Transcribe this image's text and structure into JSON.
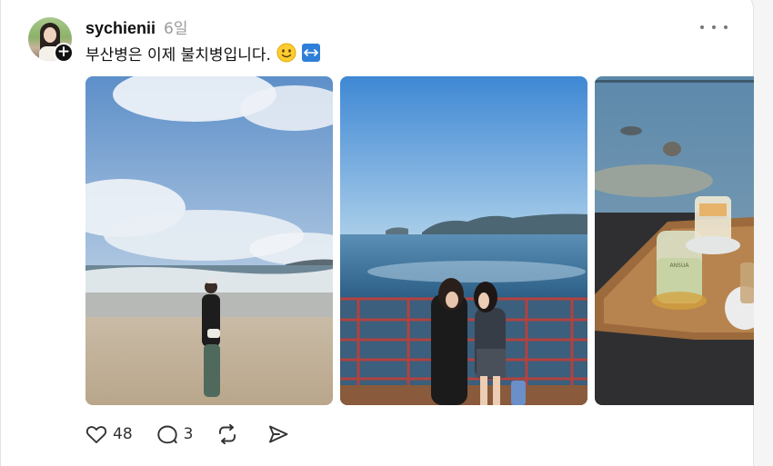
{
  "post": {
    "username": "sychienii",
    "time": "6일",
    "caption": "부산병은 이제 불치병입니다.",
    "caption_emojis": [
      "slightly-smiling-face",
      "left-right-arrow"
    ],
    "follow_symbol": "+",
    "more_label": "more-options"
  },
  "photos": [
    {
      "name": "beach-photo"
    },
    {
      "name": "ocean-terrace-photo"
    },
    {
      "name": "cafe-drinks-photo",
      "cup_text": "ANSUA"
    }
  ],
  "actions": {
    "likes": "48",
    "comments": "3",
    "repost_label": "",
    "share_label": ""
  },
  "colors": {
    "card_bg": "#ffffff",
    "page_bg": "#f5f5f5",
    "muted_text": "#9a9a9a",
    "arrow_emoji": "#2f7fd8"
  }
}
